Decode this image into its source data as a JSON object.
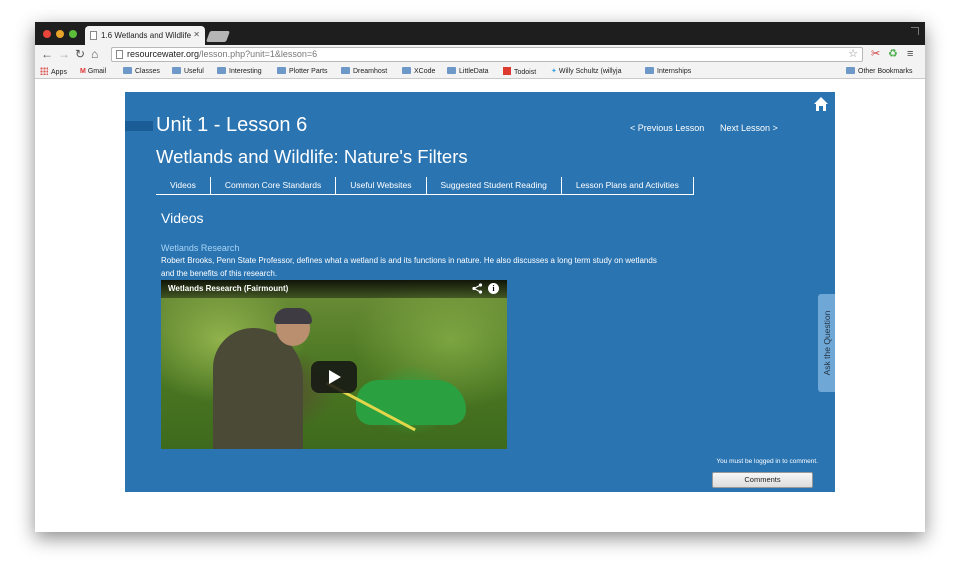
{
  "browser": {
    "tab_title": "1.6 Wetlands and Wildlife",
    "url_host": "resourcewater.org",
    "url_path": "/lesson.php?unit=1&lesson=6",
    "bookmarks": [
      {
        "label": "Apps",
        "icon": "apps-grid-icon"
      },
      {
        "label": "Gmail",
        "icon": "gmail-icon"
      },
      {
        "label": "Classes",
        "icon": "folder-icon"
      },
      {
        "label": "Useful",
        "icon": "folder-icon"
      },
      {
        "label": "Interesting",
        "icon": "folder-icon"
      },
      {
        "label": "Plotter Parts",
        "icon": "folder-icon"
      },
      {
        "label": "Dreamhost",
        "icon": "folder-icon"
      },
      {
        "label": "XCode",
        "icon": "folder-icon"
      },
      {
        "label": "LittleData",
        "icon": "folder-icon"
      },
      {
        "label": "Todoist",
        "icon": "todoist-icon"
      },
      {
        "label": "Willy Schultz (willyja",
        "icon": "twitter-icon"
      },
      {
        "label": "Internships",
        "icon": "folder-icon"
      }
    ],
    "other_bookmarks": "Other Bookmarks"
  },
  "lesson": {
    "unit_title": "Unit 1 - Lesson 6",
    "lesson_title": "Wetlands and Wildlife: Nature's Filters",
    "prev_label": "< Previous Lesson",
    "next_label": "Next Lesson >",
    "tabs": [
      "Videos",
      "Common Core Standards",
      "Useful Websites",
      "Suggested Student Reading",
      "Lesson Plans and Activities"
    ],
    "section_heading": "Videos",
    "video": {
      "title": "Wetlands Research",
      "description": "Robert Brooks, Penn State Professor, defines what a wetland is and its functions in nature. He also discusses a long term study on wetlands and the benefits of this research.",
      "player_caption": "Wetlands Research (Fairmount)"
    },
    "ask_label": "Ask the Question",
    "login_note": "You must be logged in to comment.",
    "comments_label": "Comments"
  },
  "colors": {
    "panel_bg": "#2a74b2",
    "link_light": "#a8d4f5"
  }
}
